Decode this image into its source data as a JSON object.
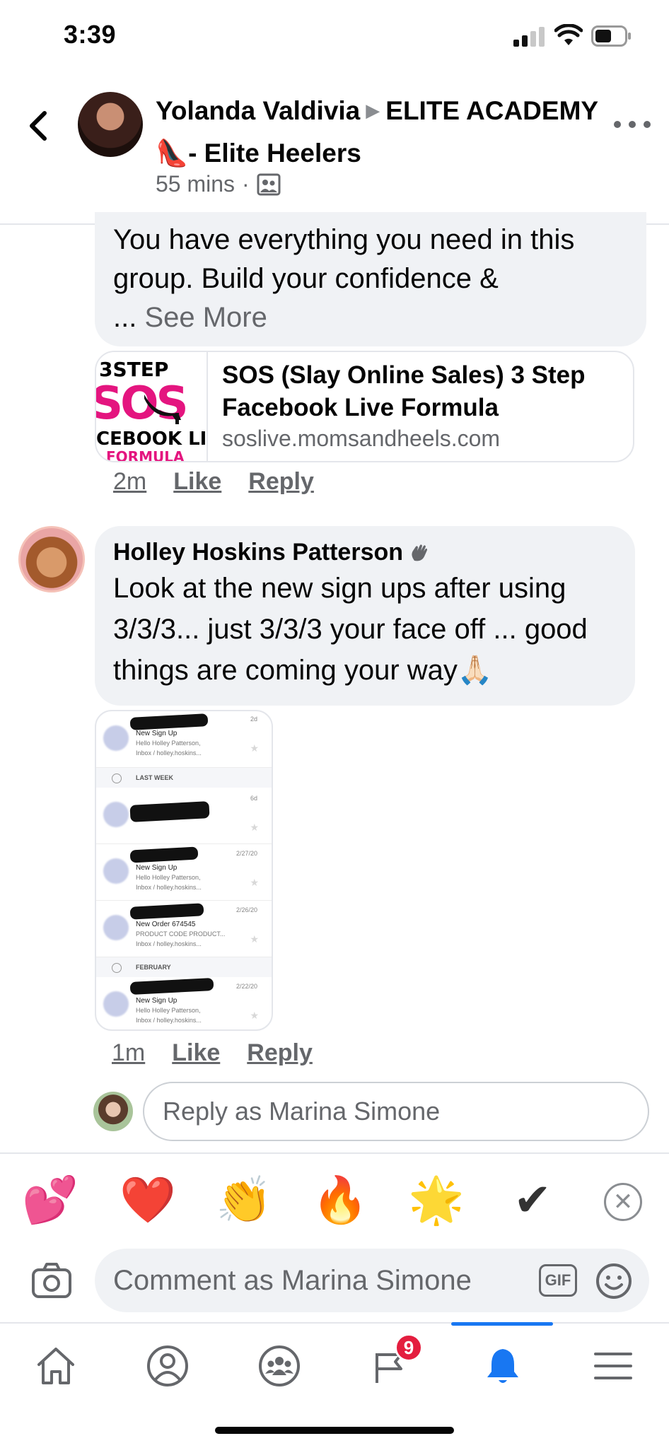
{
  "status_bar": {
    "time": "3:39"
  },
  "header": {
    "author": "Yolanda Valdivia",
    "group": "ELITE ACADEMY👠- Elite Heelers",
    "time_ago": "55 mins",
    "privacy_icon": "group-icon"
  },
  "comment1": {
    "text": "You have everything you need in this group. Build your confidence &",
    "ellipsis": "... ",
    "see_more": "See More",
    "link": {
      "title": "SOS (Slay Online Sales) 3 Step Facebook Live Formula",
      "domain": "soslive.momsandheels.com",
      "thumb_step": "3STEP",
      "thumb_sos": "SOS",
      "thumb_fb": "CEBOOK LI",
      "thumb_formula": "FORMULA"
    },
    "time": "2m",
    "like": "Like",
    "reply": "Reply"
  },
  "comment2": {
    "author": "Holley Hoskins Patterson",
    "text": "Look at the new sign ups after using 3/3/3... just 3/3/3 your face off ... good things are coming your way🙏🏻",
    "time": "1m",
    "like": "Like",
    "reply": "Reply",
    "attachment": {
      "rows": [
        {
          "subject": "New Sign Up",
          "preview": "Hello Holley Patterson,",
          "folder": "Inbox / holley.hoskins...",
          "date": "2d"
        },
        {
          "subject": "",
          "preview": "",
          "folder": "",
          "date": "6d"
        },
        {
          "subject": "New Sign Up",
          "preview": "Hello Holley Patterson,",
          "folder": "Inbox / holley.hoskins...",
          "date": "2/27/20"
        },
        {
          "subject": "New Order 674545",
          "preview": "PRODUCT CODE PRODUCT...",
          "folder": "Inbox / holley.hoskins...",
          "date": "2/26/20"
        },
        {
          "subject": "New Sign Up",
          "preview": "Hello Holley Patterson,",
          "folder": "Inbox / holley.hoskins...",
          "date": "2/22/20"
        }
      ],
      "section_last_week": "LAST WEEK",
      "section_february": "FEBRUARY"
    }
  },
  "reply_box": {
    "placeholder": "Reply as Marina Simone"
  },
  "reactions": {
    "items": [
      "💕",
      "❤️",
      "👏",
      "🔥",
      "🌟",
      "✔"
    ]
  },
  "composer": {
    "placeholder": "Comment as Marina Simone",
    "gif_label": "GIF"
  },
  "tab_bar": {
    "notifications_badge": "9",
    "active_color": "#1877f2"
  }
}
